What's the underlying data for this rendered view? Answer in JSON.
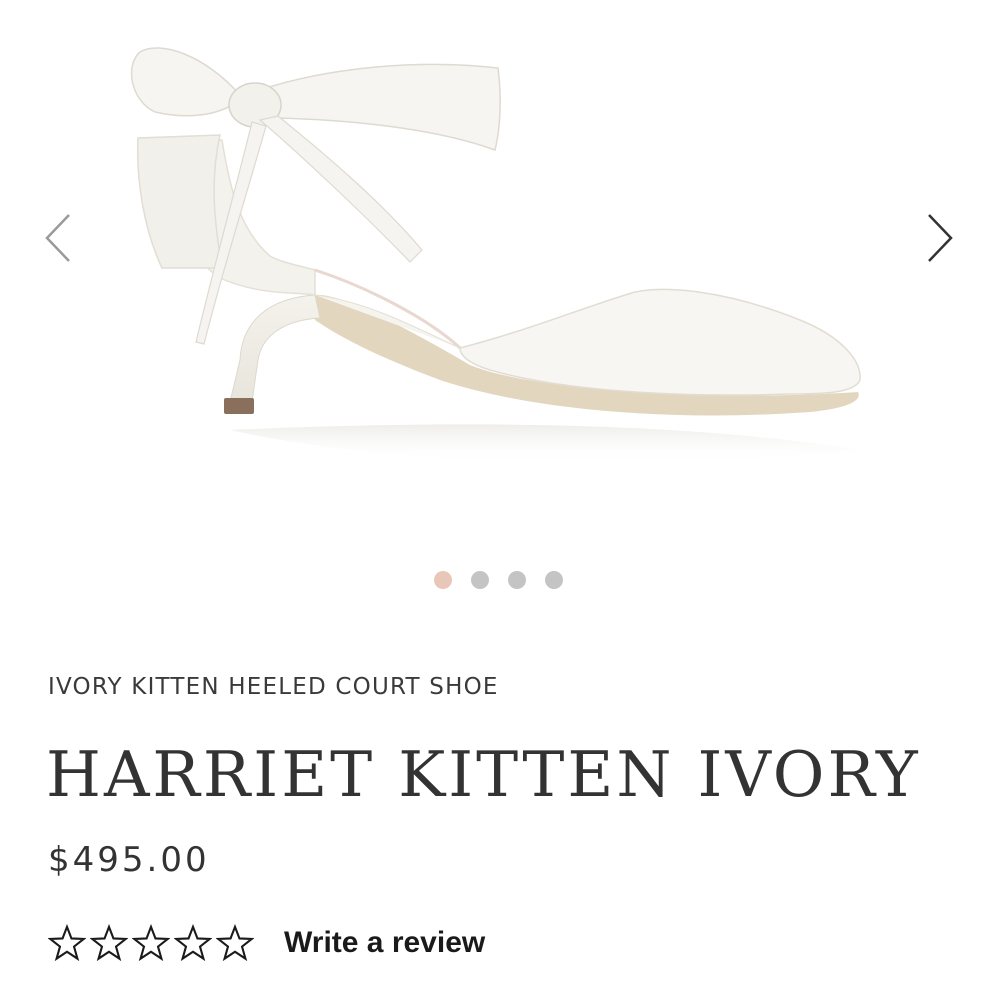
{
  "gallery": {
    "image_alt": "Ivory kitten heel court shoe with satin ankle bow",
    "prev_icon": "chevron-left-icon",
    "next_icon": "chevron-right-icon",
    "slide_count": 4,
    "active_slide": 1,
    "colors": {
      "active_dot": "#e9c7b8",
      "inactive_dot": "#c4c4c4"
    }
  },
  "product": {
    "subtitle": "IVORY KITTEN HEELED COURT SHOE",
    "title": "HARRIET KITTEN IVORY",
    "price": "$495.00",
    "rating": {
      "stars_filled": 0,
      "stars_total": 5,
      "star_icon": "star-outline-icon",
      "review_label": "Write a review"
    }
  }
}
